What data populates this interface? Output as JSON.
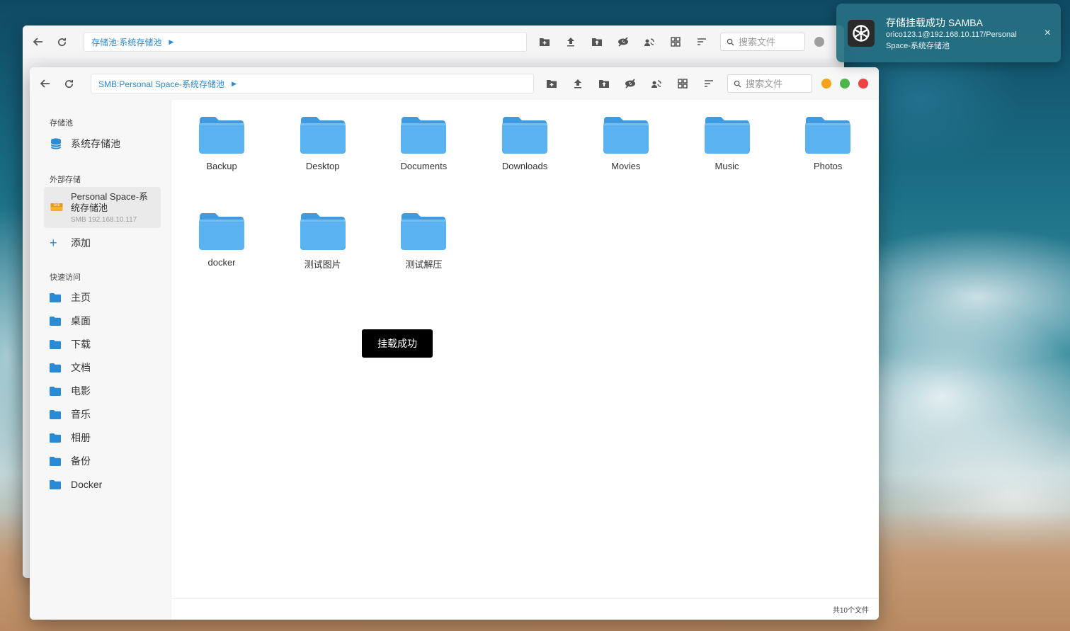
{
  "notification": {
    "title": "存储挂载成功 SAMBA",
    "body": "orico123.1@192.168.10.117/Personal Space-系统存储池",
    "close_label": "×"
  },
  "back_window": {
    "path": "存储池:系统存储池",
    "search_placeholder": "搜索文件"
  },
  "front_window": {
    "path": "SMB:Personal Space-系统存储池",
    "search_placeholder": "搜索文件",
    "window_controls": {
      "minimize_color": "#f7a21b",
      "maximize_color": "#4cb64a",
      "close_color": "#ec4343"
    }
  },
  "sidebar": {
    "storage_pool_title": "存储池",
    "storage_pool_item": "系统存储池",
    "external_title": "外部存储",
    "external_item": {
      "name": "Personal Space-系统存储池",
      "sub": "SMB 192.168.10.117"
    },
    "add_label": "添加",
    "quick_title": "快速访问",
    "quick_items": [
      "主页",
      "桌面",
      "下载",
      "文档",
      "电影",
      "音乐",
      "相册",
      "备份",
      "Docker"
    ]
  },
  "files": [
    "Backup",
    "Desktop",
    "Documents",
    "Downloads",
    "Movies",
    "Music",
    "Photos",
    "docker",
    "测试图片",
    "测试解压"
  ],
  "status": "共10个文件",
  "toast": "挂载成功",
  "colors": {
    "accent": "#2a8ad3",
    "folder": "#5ab2f0",
    "folder_tab": "#3f9ae0"
  }
}
